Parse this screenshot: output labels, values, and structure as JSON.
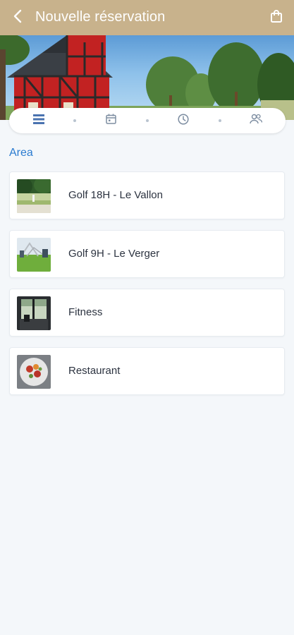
{
  "header": {
    "title": "Nouvelle réservation",
    "background": "#c8b28c",
    "back_icon": "chevron-left-icon",
    "cart_icon": "shopping-bag-icon"
  },
  "stepper": {
    "steps": [
      {
        "icon": "list-icon",
        "state": "active"
      },
      {
        "icon": "calendar-icon",
        "state": "inactive"
      },
      {
        "icon": "clock-icon",
        "state": "inactive"
      },
      {
        "icon": "users-icon",
        "state": "inactive"
      }
    ]
  },
  "section": {
    "label": "Area",
    "color": "#2a7bd0"
  },
  "areas": [
    {
      "label": "Golf 18H - Le Vallon",
      "thumb": "golf-course-photo"
    },
    {
      "label": "Golf 9H - Le Verger",
      "thumb": "golf-green-photo"
    },
    {
      "label": "Fitness",
      "thumb": "fitness-room-photo"
    },
    {
      "label": "Restaurant",
      "thumb": "food-plate-photo"
    }
  ]
}
